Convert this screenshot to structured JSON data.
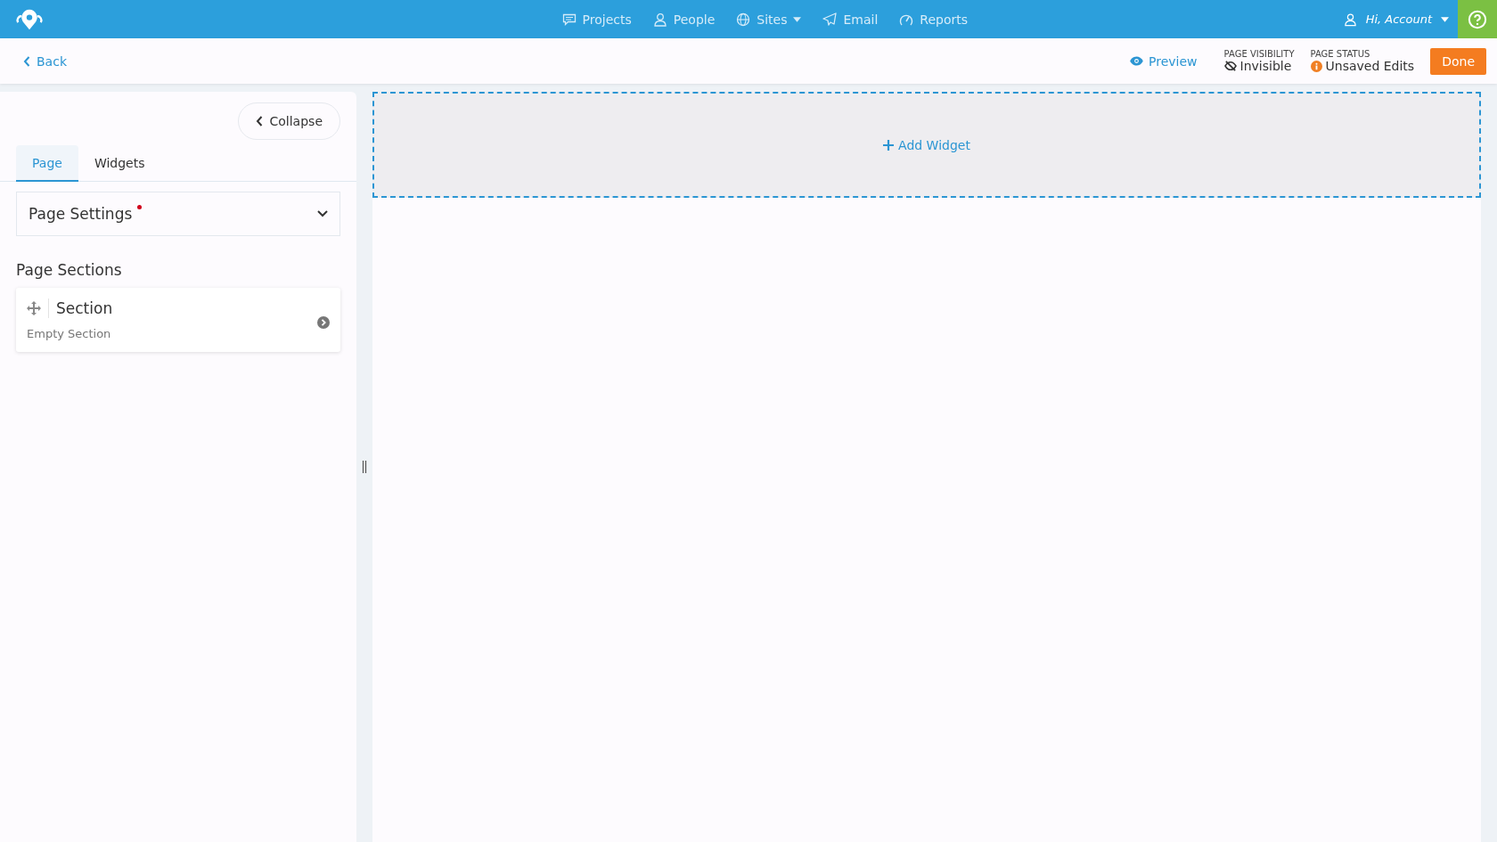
{
  "nav": [
    {
      "label": "Projects",
      "kind": "chat",
      "dropdown": false
    },
    {
      "label": "People",
      "kind": "person",
      "dropdown": false
    },
    {
      "label": "Sites",
      "kind": "globe",
      "dropdown": true
    },
    {
      "label": "Email",
      "kind": "send",
      "dropdown": false
    },
    {
      "label": "Reports",
      "kind": "gauge",
      "dropdown": false
    }
  ],
  "account": {
    "label": "Hi, Account"
  },
  "toolbar": {
    "back": "Back",
    "preview": "Preview",
    "visibility_label": "PAGE VISIBILITY",
    "visibility": "Invisible",
    "status_label": "PAGE STATUS",
    "status": "Unsaved Edits",
    "done": "Done"
  },
  "sidebar": {
    "collapse": "Collapse",
    "tabs": [
      {
        "label": "Page",
        "selected": true
      },
      {
        "label": "Widgets",
        "selected": false
      }
    ],
    "settings": {
      "label": "Page Settings",
      "modified": true
    },
    "sections_heading": "Page Sections",
    "sections": [
      {
        "title": "Section",
        "subtitle": "Empty Section"
      }
    ]
  },
  "canvas": {
    "add_widget": "Add Widget"
  }
}
